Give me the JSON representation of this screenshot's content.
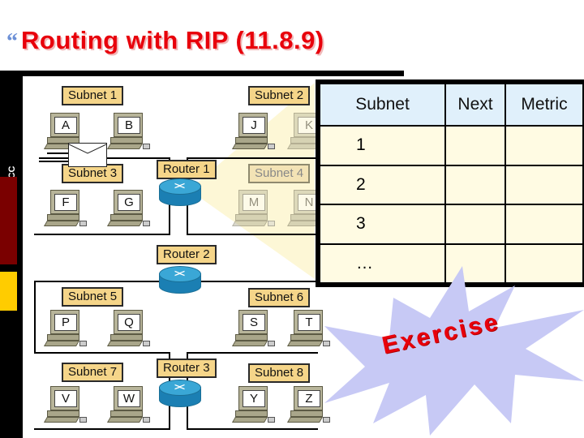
{
  "slide": {
    "bullet": "“",
    "title": "Routing with RIP (11.8.9)",
    "side_label": "CNAP @ VCC",
    "colors": {
      "title": "#e8000b",
      "accent_red": "#7a0000",
      "accent_yellow": "#ffcc00",
      "label_fill": "#f5d589",
      "router": "#1b7fb3",
      "starburst": "#c7c9f5",
      "table_header": "#e0f0fb",
      "table_body": "#fffbe3"
    }
  },
  "diagram": {
    "subnets": [
      {
        "label": "Subnet 1",
        "faded": false
      },
      {
        "label": "Subnet 2",
        "faded": false
      },
      {
        "label": "Subnet 3",
        "faded": false
      },
      {
        "label": "Subnet 4",
        "faded": true
      },
      {
        "label": "Subnet 5",
        "faded": false
      },
      {
        "label": "Subnet 6",
        "faded": false
      },
      {
        "label": "Subnet 7",
        "faded": false
      },
      {
        "label": "Subnet 8",
        "faded": false
      }
    ],
    "routers": [
      "Router 1",
      "Router 2",
      "Router 3"
    ],
    "hosts": {
      "subnet1": [
        "A",
        "B"
      ],
      "subnet2": [
        "J",
        "K"
      ],
      "subnet3": [
        "F",
        "G"
      ],
      "subnet4": [
        "M",
        "N"
      ],
      "subnet5": [
        "P",
        "Q"
      ],
      "subnet6": [
        "S",
        "T"
      ],
      "subnet7": [
        "V",
        "W"
      ],
      "subnet8": [
        "Y",
        "Z"
      ]
    },
    "packet_icon": "envelope-icon"
  },
  "routing_table": {
    "headers": [
      "Subnet",
      "Next",
      "Metric"
    ],
    "rows": [
      [
        "1",
        "",
        ""
      ],
      [
        "2",
        "",
        ""
      ],
      [
        "3",
        "",
        ""
      ],
      [
        "…",
        "",
        ""
      ]
    ]
  },
  "callout": {
    "text": "Exercise",
    "shape": "starburst"
  }
}
